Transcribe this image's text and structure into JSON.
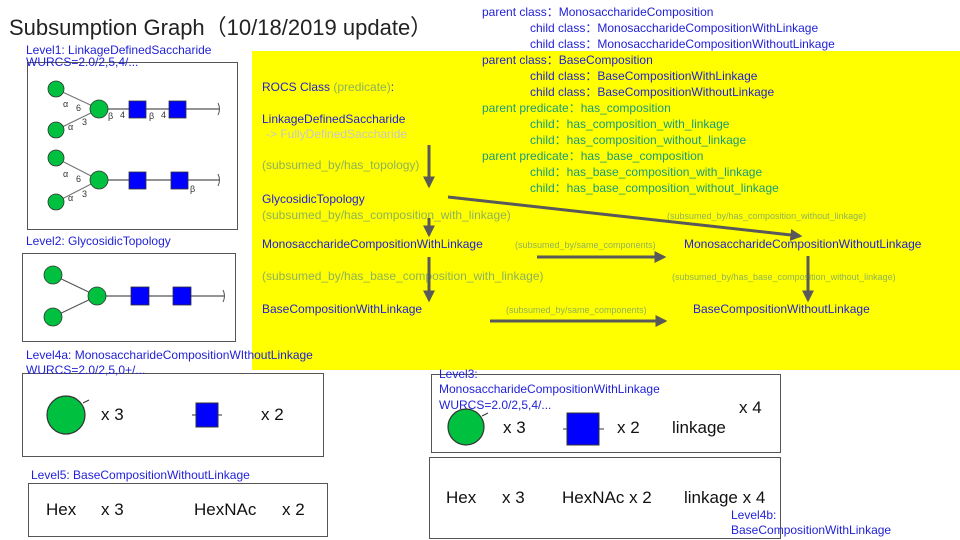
{
  "title": "Subsumption Graph（10/18/2019 update）",
  "hierarchy": {
    "parent_class_1": "parent class：MonosaccharideComposition",
    "child_class_1a": "child class：MonosaccharideCompositionWithLinkage",
    "child_class_1b": "child class：MonosaccharideCompositionWithoutLinkage",
    "parent_class_2": "parent class：BaseComposition",
    "child_class_2a": "child class：BaseCompositionWithLinkage",
    "child_class_2b": "child class：BaseCompositionWithoutLinkage",
    "parent_pred_1": "parent predicate：has_composition",
    "child_pred_1a": "child：has_composition_with_linkage",
    "child_pred_1b": "child：has_composition_without_linkage",
    "parent_pred_2": "parent predicate：has_base_composition",
    "child_pred_2a": "child：has_base_composition_with_linkage",
    "child_pred_2b": "child：has_base_composition_without_linkage"
  },
  "graph": {
    "header_class": "ROCS Class",
    "header_pred": "(predicate)",
    "header_colon": ":",
    "n_lds": "LinkageDefinedSaccharide",
    "n_fds": "-> FullyDefinedSaccharide",
    "e_topology": "(subsumed_by/has_topology)",
    "n_gt": "GlycosidicTopology",
    "e_comp_with": "(subsumed_by/has_composition_with_linkage)",
    "e_comp_without": "(subsumed_by/has_composition_without_linkage)",
    "n_mcwl": "MonosaccharideCompositionWithLinkage",
    "e_same1": "(subsumed_by/same_components)",
    "n_mcwol": "MonosaccharideCompositionWithoutLinkage",
    "e_base_with": "(subsumed_by/has_base_composition_with_linkage)",
    "e_base_without": "(subsumed_by/has_base_composition_without_linkage)",
    "n_bcwl": "BaseCompositionWithLinkage",
    "e_same2": "(subsumed_by/same_components)",
    "n_bcwol": "BaseCompositionWithoutLinkage"
  },
  "levels": {
    "l1_label": "Level1: LinkageDefinedSaccharide",
    "l1_wurcs": "WURCS=2.0/2,5,4/...",
    "l1_anno": {
      "a": "α",
      "b": "β",
      "six": "6",
      "three": "3",
      "four": "4"
    },
    "l2_label": "Level2: GlycosidicTopology",
    "l4a_label": "Level4a: MonosaccharideCompositionWIthoutLinkage",
    "l4a_wurcs": "WURCS=2.0/2,5,0+/...",
    "l4a_hex_count": "x 3",
    "l4a_hexnac_count": "x 2",
    "l5_label": "Level5: BaseCompositionWithoutLinkage",
    "l5_hex": "Hex",
    "l5_hex_count": "x 3",
    "l5_hexnac": "HexNAc",
    "l5_hexnac_count": "x 2",
    "l3_label": "Level3:",
    "l3_label2": "MonosaccharideCompositionWithLinkage",
    "l3_wurcs": "WURCS=2.0/2,5,4/...",
    "l3_hex_count": "x 3",
    "l3_hexnac_count": "x 2",
    "l3_linkage": "linkage",
    "l3_linkage_count": "x 4",
    "l4b_hex": "Hex",
    "l4b_hex_count": "x 3",
    "l4b_hexnac": "HexNAc x 2",
    "l4b_linkage": "linkage x 4",
    "l4b_label": "Level4b:",
    "l4b_label2": "BaseCompositionWithLinkage"
  },
  "colors": {
    "highlight": "#ffff00",
    "hex_green": "#00c040",
    "hexnac_blue": "#0000ff",
    "arrow": "#595959"
  }
}
